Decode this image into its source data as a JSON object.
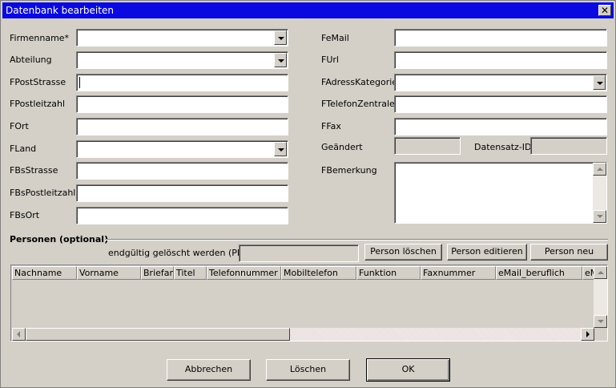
{
  "window": {
    "title": "Datenbank bearbeiten",
    "close_glyph": "✕"
  },
  "left_fields": {
    "firmenname": {
      "label": "Firmenname*",
      "value": ""
    },
    "abteilung": {
      "label": "Abteilung",
      "value": ""
    },
    "fpoststrasse": {
      "label": "FPostStrasse",
      "value": ""
    },
    "fpostleitzahl": {
      "label": "FPostleitzahl",
      "value": ""
    },
    "fort": {
      "label": "FOrt",
      "value": ""
    },
    "fland": {
      "label": "FLand",
      "value": ""
    },
    "fbsstrasse": {
      "label": "FBsStrasse",
      "value": ""
    },
    "fbspostleitzahl": {
      "label": "FBsPostleitzahl",
      "value": ""
    },
    "fbsort": {
      "label": "FBsOrt",
      "value": ""
    }
  },
  "right_fields": {
    "femail": {
      "label": "FeMail",
      "value": ""
    },
    "furl": {
      "label": "FUrl",
      "value": ""
    },
    "fadresskategorie": {
      "label": "FAdressKategorie",
      "value": ""
    },
    "ftelefonzentrale": {
      "label": "FTelefonZentrale",
      "value": ""
    },
    "ffax": {
      "label": "FFax",
      "value": ""
    },
    "geaendert": {
      "label": "Geändert",
      "value": ""
    },
    "datensatz_id": {
      "label": "Datensatz-ID",
      "value": ""
    },
    "fbemerkung": {
      "label": "FBemerkung",
      "value": ""
    }
  },
  "persons": {
    "section_title": "Personen (optional)",
    "pid_label": "endgültig gelöscht werden (PID):",
    "pid_value": "",
    "buttons": {
      "delete": "Person löschen",
      "edit": "Person editieren",
      "new": "Person neu"
    },
    "columns": [
      "Nachname",
      "Vorname",
      "Briefanr",
      "Titel",
      "Telefonnummer",
      "Mobiltelefon",
      "Funktion",
      "Faxnummer",
      "eMail_beruflich",
      "eM"
    ]
  },
  "footer": {
    "cancel": "Abbrechen",
    "delete": "Löschen",
    "ok": "OK"
  }
}
